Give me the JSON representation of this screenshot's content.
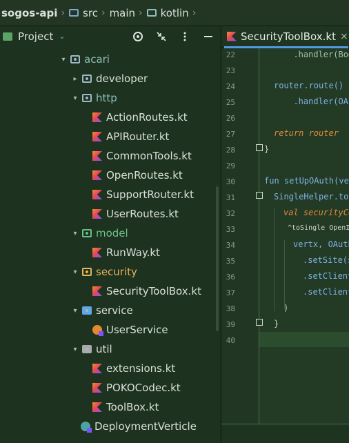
{
  "breadcrumb": {
    "items": [
      {
        "label": "sogos-api",
        "icon": "none"
      },
      {
        "label": "src",
        "icon": "source-folder-icon"
      },
      {
        "label": "main",
        "icon": "none"
      },
      {
        "label": "kotlin",
        "icon": "folder-icon"
      }
    ],
    "separator": "›"
  },
  "project_panel": {
    "title": "Project",
    "dropdown_glyph": "⌄",
    "tools": [
      "target-icon",
      "collapse-icon",
      "more-icon",
      "minimize-icon"
    ],
    "tree": [
      {
        "label": "acari",
        "kind": "package",
        "expanded": true,
        "color": "teal"
      },
      {
        "label": "developer",
        "kind": "package",
        "expanded": false
      },
      {
        "label": "http",
        "kind": "package",
        "expanded": true,
        "color": "teal"
      },
      {
        "label": "ActionRoutes.kt",
        "kind": "kotlin-file"
      },
      {
        "label": "APIRouter.kt",
        "kind": "kotlin-file"
      },
      {
        "label": "CommonTools.kt",
        "kind": "kotlin-file"
      },
      {
        "label": "OpenRoutes.kt",
        "kind": "kotlin-file"
      },
      {
        "label": "SupportRouter.kt",
        "kind": "kotlin-file"
      },
      {
        "label": "UserRoutes.kt",
        "kind": "kotlin-file"
      },
      {
        "label": "model",
        "kind": "package",
        "expanded": true,
        "color": "green"
      },
      {
        "label": "RunWay.kt",
        "kind": "kotlin-file"
      },
      {
        "label": "security",
        "kind": "package",
        "expanded": true,
        "color": "orange"
      },
      {
        "label": "SecurityToolBox.kt",
        "kind": "kotlin-file"
      },
      {
        "label": "service",
        "kind": "package",
        "expanded": true,
        "color": "blue"
      },
      {
        "label": "UserService",
        "kind": "kotlin-class"
      },
      {
        "label": "util",
        "kind": "package",
        "expanded": true,
        "color": "gray"
      },
      {
        "label": "extensions.kt",
        "kind": "kotlin-file"
      },
      {
        "label": "POKOCodec.kt",
        "kind": "kotlin-file"
      },
      {
        "label": "ToolBox.kt",
        "kind": "kotlin-file"
      },
      {
        "label": "DeploymentVerticle",
        "kind": "kotlin-class"
      }
    ]
  },
  "editor": {
    "tab": {
      "label": "SecurityToolBox.kt",
      "close_glyph": "×"
    },
    "current_line": 40,
    "lines": [
      {
        "n": "22",
        "text": "  .handler(BodyH"
      },
      {
        "n": "23",
        "text": ""
      },
      {
        "n": "24",
        "text": "router.route()"
      },
      {
        "n": "25",
        "text": "  .handler(OAuth"
      },
      {
        "n": "26",
        "text": ""
      },
      {
        "n": "27",
        "text": "return router"
      },
      {
        "n": "28",
        "text": "}"
      },
      {
        "n": "29",
        "text": ""
      },
      {
        "n": "30",
        "text": "fun setUpOAuth(ver"
      },
      {
        "n": "31",
        "text": "SingleHelper.toS"
      },
      {
        "n": "32",
        "text": "val securityCo"
      },
      {
        "n": "33",
        "text": "^toSingle OpenI"
      },
      {
        "n": "34",
        "text": "vertx, OAuth"
      },
      {
        "n": "35",
        "text": ".setSite(s"
      },
      {
        "n": "36",
        "text": ".setClient"
      },
      {
        "n": "37",
        "text": ".setClient"
      },
      {
        "n": "38",
        "text": ")"
      },
      {
        "n": "39",
        "text": "}"
      },
      {
        "n": "40",
        "text": ""
      }
    ]
  },
  "colors": {
    "background": "#1e3320",
    "editor_background": "#233a25",
    "keyword": "#e08a3a",
    "function_name": "#7fb2e6",
    "tab_underline": "#4f9be2"
  }
}
